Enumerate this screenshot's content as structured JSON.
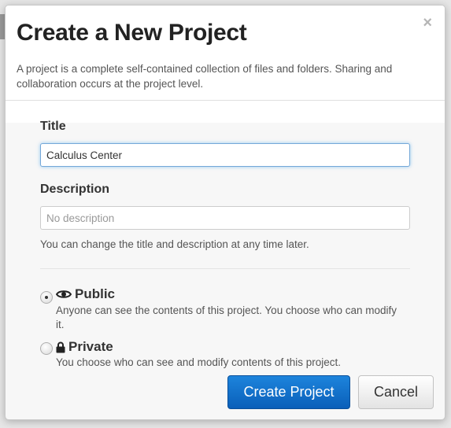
{
  "dialog": {
    "title": "Create a New Project",
    "close_label": "×",
    "description": "A project is a complete self-contained collection of files and folders. Sharing and collaboration occurs at the project level."
  },
  "form": {
    "title_label": "Title",
    "title_value": "Calculus Center",
    "description_label": "Description",
    "description_placeholder": "No description",
    "help_text": "You can change the title and description at any time later."
  },
  "visibility": {
    "selected": "public",
    "options": [
      {
        "id": "public",
        "icon": "eye-icon",
        "label": "Public",
        "description": "Anyone can see the contents of this project. You choose who can modify it."
      },
      {
        "id": "private",
        "icon": "lock-icon",
        "label": "Private",
        "description": "You choose who can see and modify contents of this project."
      }
    ]
  },
  "actions": {
    "create_label": "Create Project",
    "cancel_label": "Cancel"
  },
  "colors": {
    "primary_button": "#0a6bc9",
    "focus_glow": "#52a8ec"
  }
}
